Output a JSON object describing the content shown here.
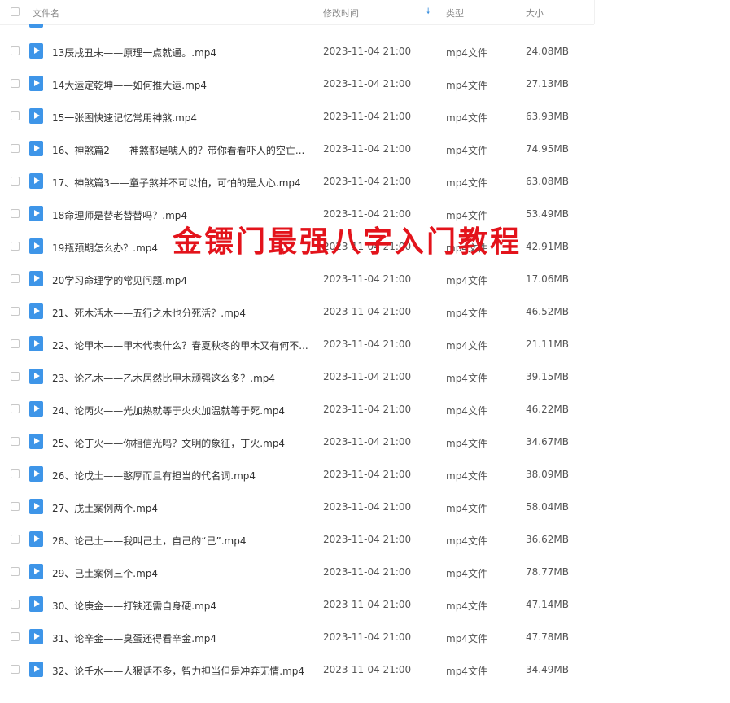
{
  "header": {
    "name": "文件名",
    "time": "修改时间",
    "sort_icon": "sort-down-arrow",
    "type": "类型",
    "size": "大小"
  },
  "watermark": "金镖门最强八字入门教程",
  "rows": [
    {
      "name": "13辰戌丑未——原理一点就通。.mp4",
      "time": "2023-11-04 21:00",
      "type": "mp4文件",
      "size": "24.08MB"
    },
    {
      "name": "14大运定乾坤——如何推大运.mp4",
      "time": "2023-11-04 21:00",
      "type": "mp4文件",
      "size": "27.13MB"
    },
    {
      "name": "15一张图快速记忆常用神煞.mp4",
      "time": "2023-11-04 21:00",
      "type": "mp4文件",
      "size": "63.93MB"
    },
    {
      "name": "16、神煞篇2——神煞都是唬人的？带你看看吓人的空亡...",
      "time": "2023-11-04 21:00",
      "type": "mp4文件",
      "size": "74.95MB"
    },
    {
      "name": "17、神煞篇3——童子煞并不可以怕，可怕的是人心.mp4",
      "time": "2023-11-04 21:00",
      "type": "mp4文件",
      "size": "63.08MB"
    },
    {
      "name": "18命理师是替老替替吗？.mp4",
      "time": "2023-11-04 21:00",
      "type": "mp4文件",
      "size": "53.49MB"
    },
    {
      "name": "19瓶颈期怎么办？.mp4",
      "time": "2023-11-04 21:00",
      "type": "mp4文件",
      "size": "42.91MB"
    },
    {
      "name": "20学习命理学的常见问题.mp4",
      "time": "2023-11-04 21:00",
      "type": "mp4文件",
      "size": "17.06MB"
    },
    {
      "name": "21、死木活木——五行之木也分死活？.mp4",
      "time": "2023-11-04 21:00",
      "type": "mp4文件",
      "size": "46.52MB"
    },
    {
      "name": "22、论甲木——甲木代表什么？春夏秋冬的甲木又有何不...",
      "time": "2023-11-04 21:00",
      "type": "mp4文件",
      "size": "21.11MB"
    },
    {
      "name": "23、论乙木——乙木居然比甲木顽强这么多？.mp4",
      "time": "2023-11-04 21:00",
      "type": "mp4文件",
      "size": "39.15MB"
    },
    {
      "name": "24、论丙火——光加热就等于火火加温就等于死.mp4",
      "time": "2023-11-04 21:00",
      "type": "mp4文件",
      "size": "46.22MB"
    },
    {
      "name": "25、论丁火——你相信光吗？文明的象征，丁火.mp4",
      "time": "2023-11-04 21:00",
      "type": "mp4文件",
      "size": "34.67MB"
    },
    {
      "name": "26、论戊土——憨厚而且有担当的代名词.mp4",
      "time": "2023-11-04 21:00",
      "type": "mp4文件",
      "size": "38.09MB"
    },
    {
      "name": "27、戊土案例两个.mp4",
      "time": "2023-11-04 21:00",
      "type": "mp4文件",
      "size": "58.04MB"
    },
    {
      "name": "28、论己土——我叫己土，自己的“己”.mp4",
      "time": "2023-11-04 21:00",
      "type": "mp4文件",
      "size": "36.62MB"
    },
    {
      "name": "29、己土案例三个.mp4",
      "time": "2023-11-04 21:00",
      "type": "mp4文件",
      "size": "78.77MB"
    },
    {
      "name": "30、论庚金——打铁还需自身硬.mp4",
      "time": "2023-11-04 21:00",
      "type": "mp4文件",
      "size": "47.14MB"
    },
    {
      "name": "31、论辛金——臭蛋还得看辛金.mp4",
      "time": "2023-11-04 21:00",
      "type": "mp4文件",
      "size": "47.78MB"
    },
    {
      "name": "32、论壬水——人狠话不多，智力担当但是冲弃无情.mp4",
      "time": "2023-11-04 21:00",
      "type": "mp4文件",
      "size": "34.49MB"
    }
  ]
}
